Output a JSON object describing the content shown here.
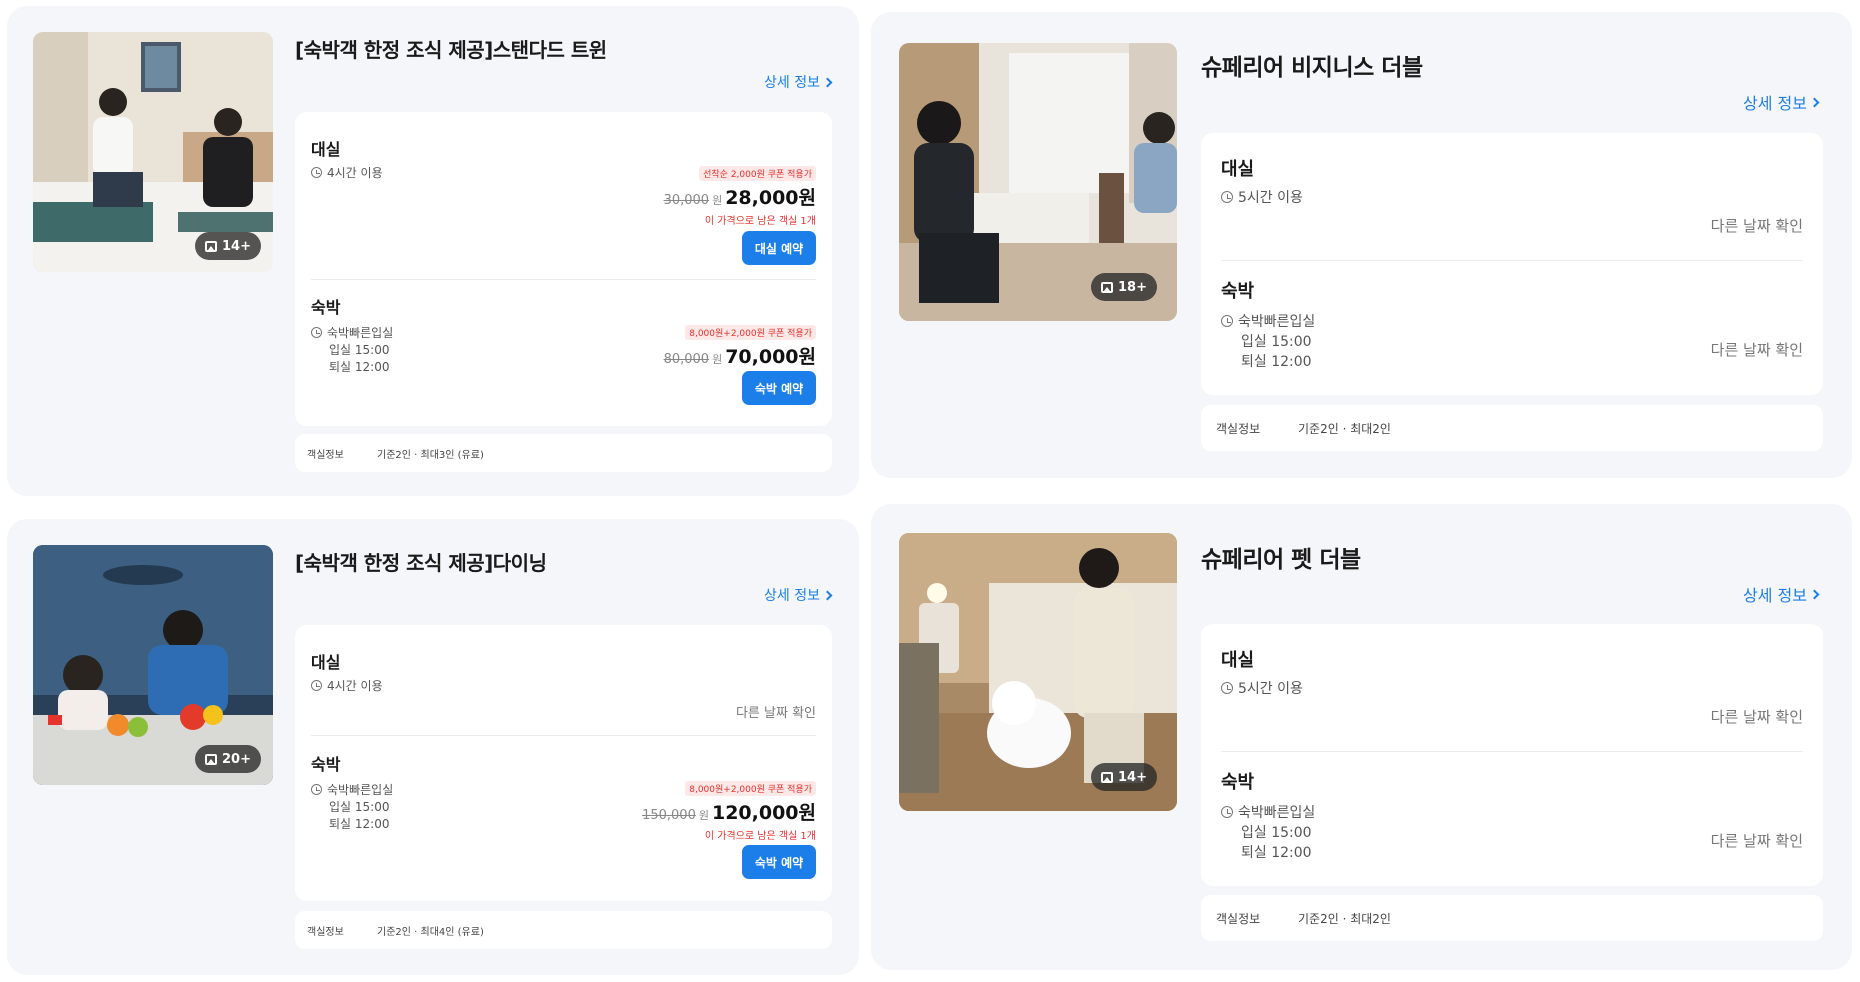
{
  "cards": [
    {
      "title": "[숙박객 한정 조식 제공]스탠다드 트윈",
      "detail_label": "상세 정보",
      "photo_count": "14+",
      "daytime": {
        "label": "대실",
        "duration": "4시간 이용",
        "coupon": "선착순 2,000원 쿠폰 적용가",
        "original_price": "30,000",
        "won": "원",
        "final_price": "28,000원",
        "remaining": "이 가격으로 남은 객실 1개",
        "button": "대실 예약"
      },
      "stay": {
        "label": "숙박",
        "type": "숙박빠른입실",
        "checkin": "입실 15:00",
        "checkout": "퇴실 12:00",
        "coupon": "8,000원+2,000원 쿠폰 적용가",
        "original_price": "80,000",
        "won": "원",
        "final_price": "70,000원",
        "button": "숙박 예약"
      },
      "room_info": {
        "label": "객실정보",
        "value": "기준2인 · 최대3인 (유료)"
      }
    },
    {
      "title": "슈페리어 비지니스 더블",
      "detail_label": "상세 정보",
      "photo_count": "18+",
      "daytime": {
        "label": "대실",
        "duration": "5시간 이용",
        "other_date": "다른 날짜 확인"
      },
      "stay": {
        "label": "숙박",
        "type": "숙박빠른입실",
        "checkin": "입실 15:00",
        "checkout": "퇴실 12:00",
        "other_date": "다른 날짜 확인"
      },
      "room_info": {
        "label": "객실정보",
        "value": "기준2인 · 최대2인"
      }
    },
    {
      "title": "[숙박객 한정 조식 제공]다이닝",
      "detail_label": "상세 정보",
      "photo_count": "20+",
      "daytime": {
        "label": "대실",
        "duration": "4시간 이용",
        "other_date": "다른 날짜 확인"
      },
      "stay": {
        "label": "숙박",
        "type": "숙박빠른입실",
        "checkin": "입실 15:00",
        "checkout": "퇴실 12:00",
        "coupon": "8,000원+2,000원 쿠폰 적용가",
        "original_price": "150,000",
        "won": "원",
        "final_price": "120,000원",
        "remaining": "이 가격으로 남은 객실 1개",
        "button": "숙박 예약"
      },
      "room_info": {
        "label": "객실정보",
        "value": "기준2인 · 최대4인 (유료)"
      }
    },
    {
      "title": "슈페리어 펫 더블",
      "detail_label": "상세 정보",
      "photo_count": "14+",
      "daytime": {
        "label": "대실",
        "duration": "5시간 이용",
        "other_date": "다른 날짜 확인"
      },
      "stay": {
        "label": "숙박",
        "type": "숙박빠른입실",
        "checkin": "입실 15:00",
        "checkout": "퇴실 12:00",
        "other_date": "다른 날짜 확인"
      },
      "room_info": {
        "label": "객실정보",
        "value": "기준2인 · 최대2인"
      }
    }
  ],
  "colors": {
    "accent": "#1c7ee8",
    "sale": "#e6302d",
    "card_bg": "#f5f6fa"
  }
}
